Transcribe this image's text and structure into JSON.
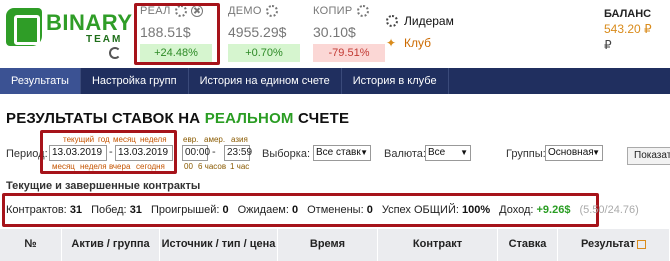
{
  "brand": {
    "name": "BINARY",
    "sub": "TEAM"
  },
  "accounts": [
    {
      "title": "РЕАЛ",
      "amount": "188.51$",
      "delta": "+24.48%",
      "delta_type": "pos"
    },
    {
      "title": "ДЕМО",
      "amount": "4955.29$",
      "delta": "+0.70%",
      "delta_type": "pos"
    },
    {
      "title": "КОПИР",
      "amount": "30.10$",
      "delta": "-79.51%",
      "delta_type": "neg"
    }
  ],
  "links": {
    "leaders": "Лидерам",
    "club": "Клуб"
  },
  "balance": {
    "label": "БАЛАНС",
    "value": "543.20 ₽",
    "icon": "₽"
  },
  "nav": {
    "tabs": [
      {
        "label": "Результаты"
      },
      {
        "label": "Настройка групп"
      },
      {
        "label": "История на едином счете"
      },
      {
        "label": "История в клубе"
      }
    ]
  },
  "title": {
    "prefix": "РЕЗУЛЬТАТЫ СТАВОК НА ",
    "highlight": "РЕАЛЬНОМ",
    "suffix": " СЧЕТЕ"
  },
  "filters": {
    "period_label": "Период:",
    "top_quick": [
      "текущий",
      "год",
      "месяц",
      "неделя"
    ],
    "bottom_quick": [
      "месяц",
      "неделя",
      "вчера",
      "сегодня"
    ],
    "date_from": "13.03.2019",
    "date_to": "13.03.2019",
    "date_sep": "-",
    "time_top": [
      "евр.",
      "амер.",
      "азия"
    ],
    "time_from": "00:00",
    "time_to": "23:59",
    "time_sep": "-",
    "time_bottom": [
      "00",
      "6 часов",
      "1 час"
    ],
    "sample_label": "Выборка:",
    "sample_value": "Все ставк",
    "currency_label": "Валюта:",
    "currency_value": "Все",
    "groups_label": "Группы:",
    "groups_value": "Основная",
    "show_button": "Показат"
  },
  "contracts": {
    "title": "Текущие и завершенные контракты",
    "stats": {
      "contracts_label": "Контрактов:",
      "contracts": "31",
      "wins_label": "Побед:",
      "wins": "31",
      "losses_label": "Проигрышей:",
      "losses": "0",
      "pending_label": "Ожидаем:",
      "pending": "0",
      "canceled_label": "Отменены:",
      "canceled": "0",
      "success_label": "Успех ОБЩИЙ:",
      "success": "100%",
      "income_label": "Доход:",
      "income": "+9.26$",
      "income_extra": "(5.50/24.76)"
    }
  },
  "table": {
    "headers": [
      "№",
      "Актив / группа",
      "Источник / тип / цена",
      "Время",
      "Контракт",
      "Ставка",
      "Результат"
    ]
  },
  "colors": {
    "nav_bg": "#202f5f",
    "nav_active": "#3b5293",
    "brand_green": "#2f9d27",
    "highlight": "#a6131a",
    "accent_orange": "#d98b1b"
  }
}
